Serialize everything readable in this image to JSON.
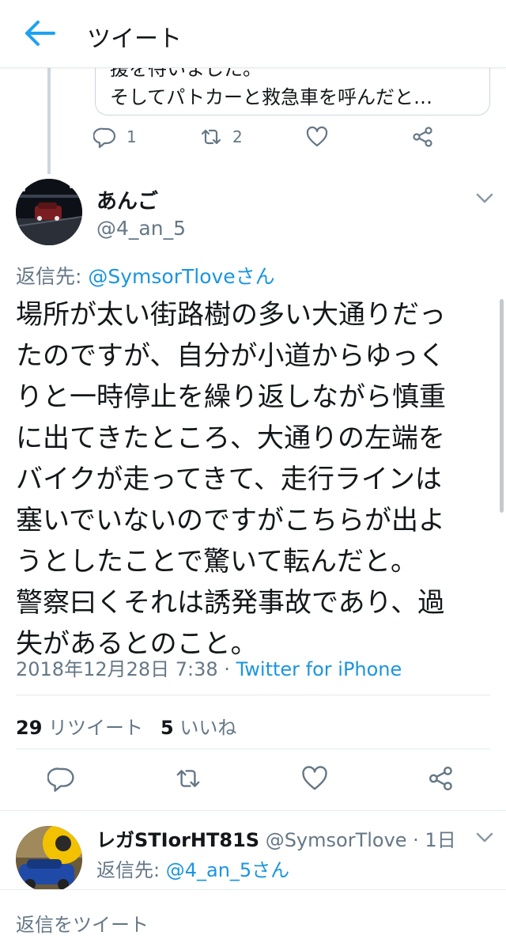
{
  "header": {
    "title": "ツイート"
  },
  "prev_tweet": {
    "text_lines": [
      "援を待いました。",
      "そしてパトカーと救急車を呼んだと…"
    ],
    "reply_count": "1",
    "retweet_count": "2"
  },
  "tweet": {
    "display_name": "あんご",
    "handle": "@4_an_5",
    "reply_prefix": "返信先: ",
    "reply_to": "@SymsorTloveさん",
    "body_lines": [
      "場所が太い街路樹の多い大通りだっ",
      "たのですが、自分が小道からゆっく",
      "りと一時停止を繰り返しながら慎重",
      "に出てきたところ、大通りの左端を",
      "バイクが走ってきて、走行ラインは",
      "塞いでいないのですがこちらが出よ",
      "うとしたことで驚いて転んだと。",
      "警察曰くそれは誘発事故であり、過",
      "失があるとのこと。"
    ],
    "timestamp": "2018年12月28日 7:38 · ",
    "client": "Twitter for iPhone",
    "retweets_count": "29",
    "retweets_label": "リツイート",
    "likes_count": "5",
    "likes_label": "いいね"
  },
  "reply_tweet": {
    "display_name": "レガSTIorHT81S",
    "meta": " @SymsorTlove · 1日",
    "reply_prefix": "返信先: ",
    "reply_to": "@4_an_5さん"
  },
  "composer": {
    "placeholder": "返信をツイート"
  },
  "colors": {
    "accent": "#1b95e0",
    "secondary_text": "#657786",
    "border": "#e6ecf0"
  },
  "icons": [
    "back-arrow-icon",
    "reply-icon",
    "retweet-icon",
    "like-icon",
    "share-icon",
    "caret-down-icon"
  ]
}
